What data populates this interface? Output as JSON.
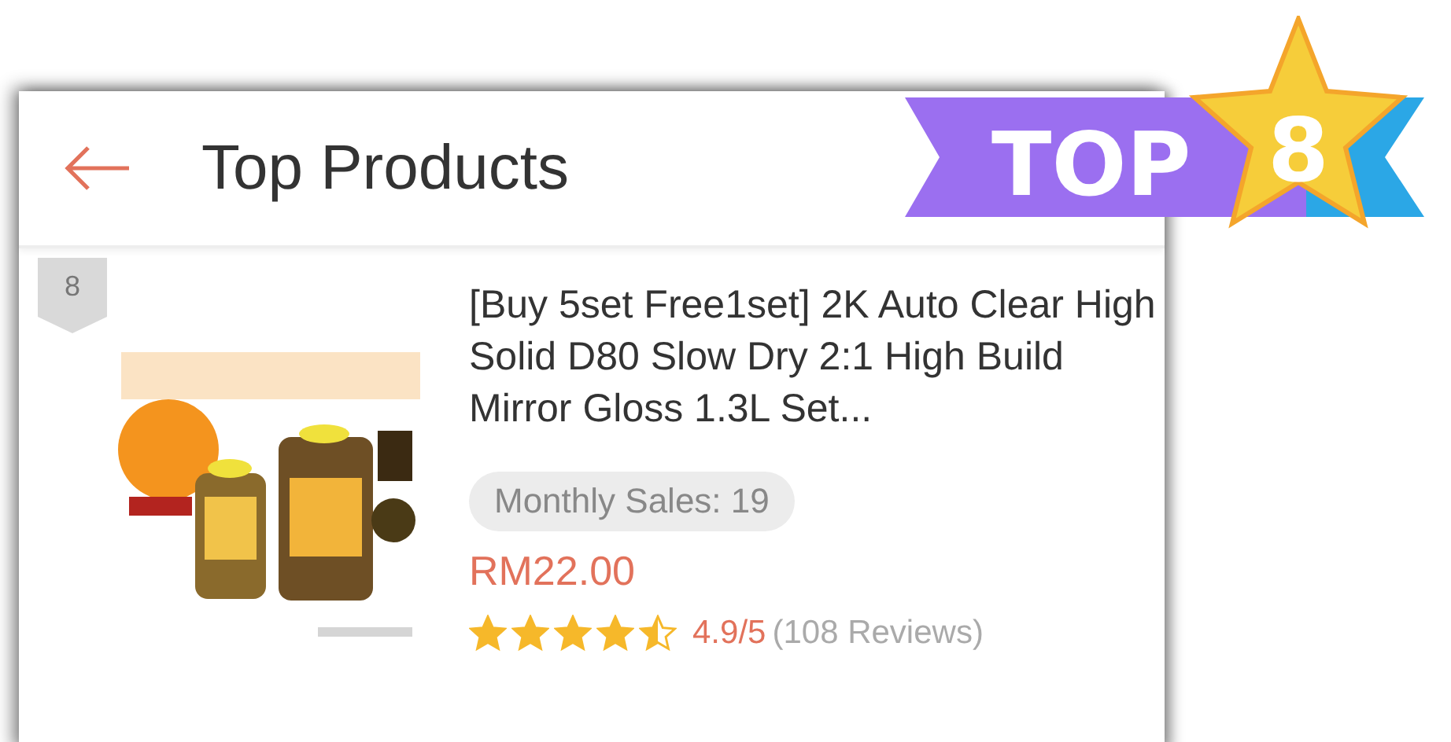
{
  "header": {
    "title": "Top Products"
  },
  "badge": {
    "label": "TOP",
    "rank": "8"
  },
  "product": {
    "rank": "8",
    "title": "[Buy 5set Free1set] 2K Auto Clear High Solid D80 Slow Dry 2:1 High Build Mirror Gloss 1.3L Set...",
    "monthly_sales": "Monthly Sales: 19",
    "price": "RM22.00",
    "stars": 4.5,
    "rating": "4.9/5",
    "reviews": "(108 Reviews)"
  }
}
